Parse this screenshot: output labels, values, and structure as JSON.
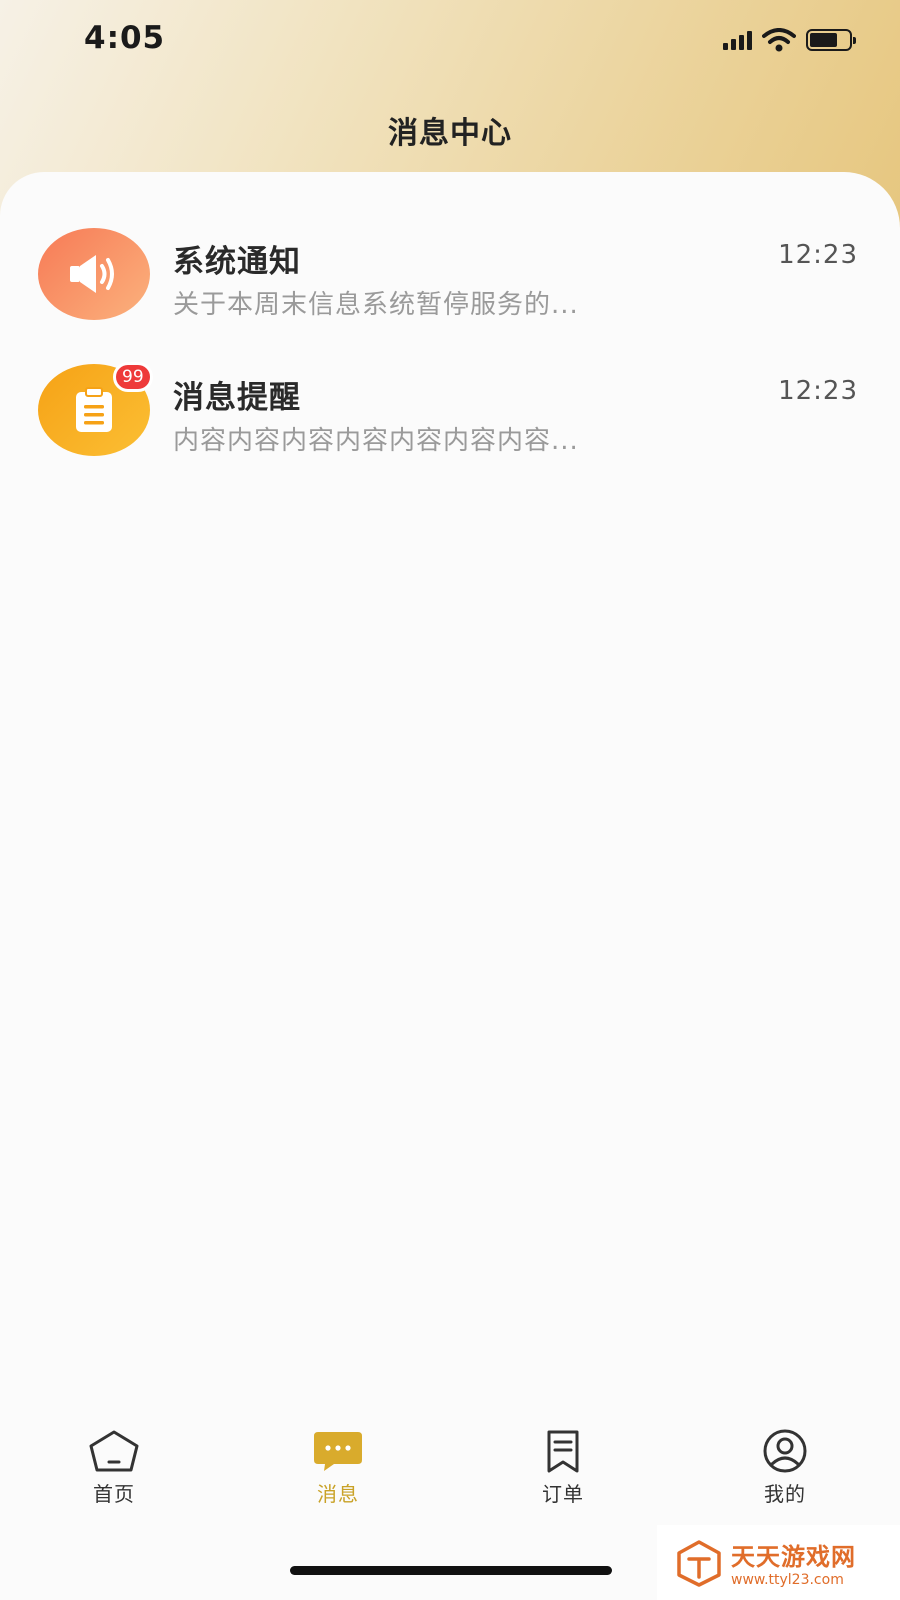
{
  "status_bar": {
    "time": "4:05"
  },
  "header": {
    "title": "消息中心"
  },
  "messages": [
    {
      "title": "系统通知",
      "preview": "关于本周末信息系统暂停服务的...",
      "time": "12:23",
      "icon": "speaker-icon",
      "color": "#f77a56"
    },
    {
      "title": "消息提醒",
      "preview": "内容内容内容内容内容内容内容...",
      "time": "12:23",
      "icon": "clipboard-icon",
      "color": "#f6a216",
      "badge": "99"
    }
  ],
  "tabbar": {
    "items": [
      {
        "label": "首页",
        "icon": "home-icon",
        "active": false
      },
      {
        "label": "消息",
        "icon": "chat-icon",
        "active": true
      },
      {
        "label": "订单",
        "icon": "order-icon",
        "active": false
      },
      {
        "label": "我的",
        "icon": "profile-icon",
        "active": false
      }
    ],
    "active_color": "#c9a227"
  },
  "watermark": {
    "title": "天天游戏网",
    "url": "www.ttyl23.com"
  }
}
